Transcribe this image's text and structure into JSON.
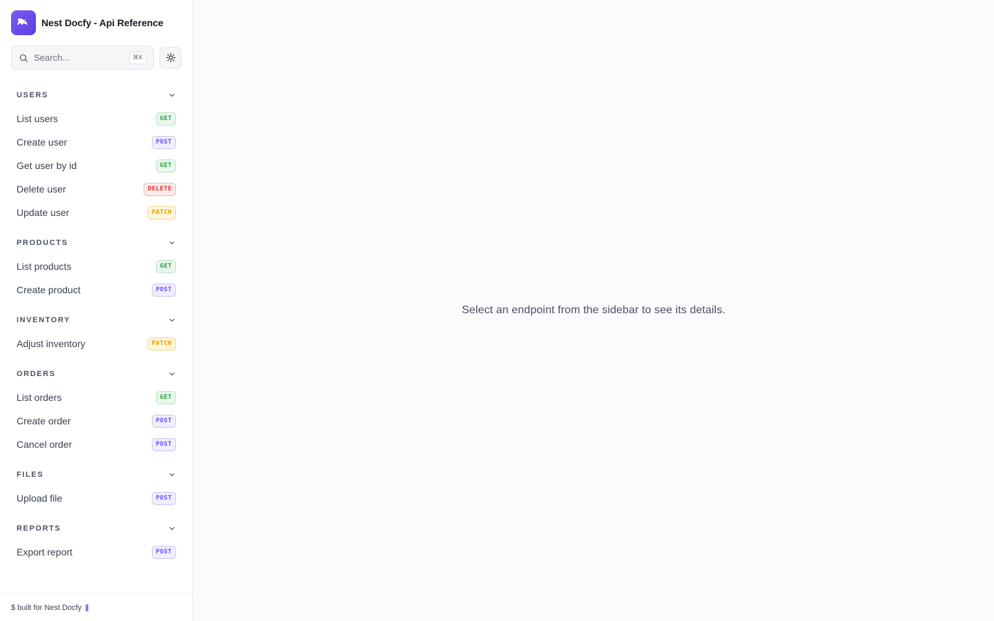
{
  "brand": {
    "title": "Nest Docfy - Api Reference"
  },
  "search": {
    "placeholder": "Search...",
    "shortcut": "⌘K"
  },
  "sidebar": {
    "groups": [
      {
        "title": "USERS",
        "items": [
          {
            "label": "List users",
            "method": "GET"
          },
          {
            "label": "Create user",
            "method": "POST"
          },
          {
            "label": "Get user by id",
            "method": "GET"
          },
          {
            "label": "Delete user",
            "method": "DELETE"
          },
          {
            "label": "Update user",
            "method": "PATCH"
          }
        ]
      },
      {
        "title": "PRODUCTS",
        "items": [
          {
            "label": "List products",
            "method": "GET"
          },
          {
            "label": "Create product",
            "method": "POST"
          }
        ]
      },
      {
        "title": "INVENTORY",
        "items": [
          {
            "label": "Adjust inventory",
            "method": "PATCH"
          }
        ]
      },
      {
        "title": "ORDERS",
        "items": [
          {
            "label": "List orders",
            "method": "GET"
          },
          {
            "label": "Create order",
            "method": "POST"
          },
          {
            "label": "Cancel order",
            "method": "POST"
          }
        ]
      },
      {
        "title": "FILES",
        "items": [
          {
            "label": "Upload file",
            "method": "POST"
          }
        ]
      },
      {
        "title": "REPORTS",
        "items": [
          {
            "label": "Export report",
            "method": "POST"
          }
        ]
      }
    ]
  },
  "footer": {
    "text": "$ built for Nest Docfy"
  },
  "main": {
    "empty_message": "Select an endpoint from the sidebar to see its details."
  },
  "colors": {
    "accent": "#6b52e8",
    "get": "#2f9e44",
    "post": "#6b52e8",
    "delete": "#e03131",
    "patch": "#e6a000"
  }
}
